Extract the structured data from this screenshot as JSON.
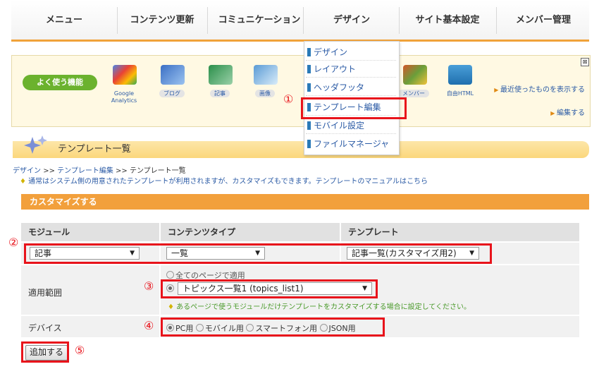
{
  "nav": {
    "items": [
      "メニュー",
      "コンテンツ更新",
      "コミュニケーション",
      "デザイン",
      "サイト基本設定",
      "メンバー管理"
    ]
  },
  "dropdown": {
    "items": [
      "デザイン",
      "レイアウト",
      "ヘッダフッタ",
      "テンプレート編集",
      "モバイル設定",
      "ファイルマネージャ"
    ]
  },
  "quick": {
    "title": "よく使う機能",
    "items": [
      "Google Analytics",
      "ブログ",
      "記事",
      "画像",
      "メンバー",
      "自由HTML"
    ],
    "link_recent": "最近使ったものを表示する",
    "link_edit": "編集する",
    "close": "⊠"
  },
  "page": {
    "title": "テンプレート一覧",
    "breadcrumb": {
      "design": "デザイン",
      "template_edit": "テンプレート編集",
      "current": "テンプレート一覧",
      "sep": ">>"
    },
    "note": "通常はシステム側の用意されたテンプレートが利用されますが、カスタマイズもできます。テンプレートのマニュアルは",
    "note_link": "こちら",
    "customize": "カスタマイズする"
  },
  "form": {
    "headers": [
      "モジュール",
      "コンテンツタイプ",
      "テンプレート"
    ],
    "module_value": "記事",
    "content_type_value": "一覧",
    "template_value": "記事一覧(カスタマイズ用2)",
    "scope_label": "適用範囲",
    "scope_all": "全てのページで適用",
    "scope_select": "トピックス一覧1 (topics_list1)",
    "scope_hint": "あるページで使うモジュールだけテンプレートをカスタマイズする場合に設定してください。",
    "device_label": "デバイス",
    "devices": [
      "PC用",
      "モバイル用",
      "スマートフォン用",
      "JSON用"
    ],
    "add_button": "追加する"
  },
  "annotations": [
    "①",
    "②",
    "③",
    "④",
    "⑤"
  ],
  "colors": {
    "accent_orange": "#f2a03c",
    "highlight_red": "#e8131b",
    "link_blue": "#2a5aa5",
    "pill_green": "#6bb22e"
  }
}
